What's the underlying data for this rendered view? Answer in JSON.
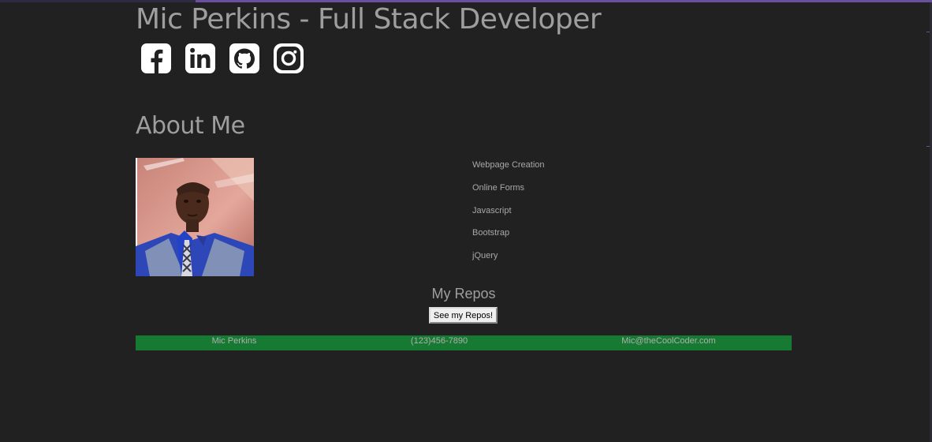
{
  "header": {
    "title": "Mic Perkins - Full Stack Developer"
  },
  "social": [
    {
      "icon": "facebook-icon"
    },
    {
      "icon": "linkedin-icon"
    },
    {
      "icon": "github-icon"
    },
    {
      "icon": "instagram-icon"
    }
  ],
  "about": {
    "title": "About Me",
    "skills": [
      "Webpage Creation",
      "Online Forms",
      "Javascript",
      "Bootstrap",
      "jQuery"
    ]
  },
  "repos": {
    "title": "My Repos",
    "button_label": "See my Repos!"
  },
  "footer": {
    "name": "Mic Perkins",
    "phone": "(123)456-7890",
    "email": "Mic@theCoolCoder.com"
  },
  "colors": {
    "background": "#212121",
    "text": "#9e9e9e",
    "footer": "#167a32",
    "accent_line": "#6a4fa0"
  }
}
